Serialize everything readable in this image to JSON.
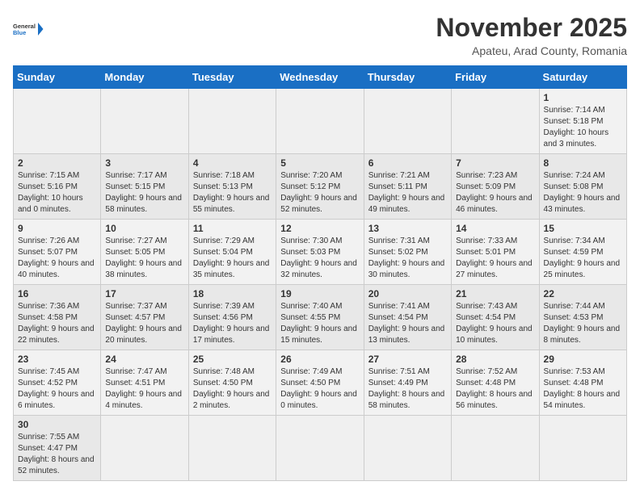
{
  "logo": {
    "text_general": "General",
    "text_blue": "Blue"
  },
  "title": "November 2025",
  "subtitle": "Apateu, Arad County, Romania",
  "weekdays": [
    "Sunday",
    "Monday",
    "Tuesday",
    "Wednesday",
    "Thursday",
    "Friday",
    "Saturday"
  ],
  "weeks": [
    [
      {
        "day": "",
        "info": ""
      },
      {
        "day": "",
        "info": ""
      },
      {
        "day": "",
        "info": ""
      },
      {
        "day": "",
        "info": ""
      },
      {
        "day": "",
        "info": ""
      },
      {
        "day": "",
        "info": ""
      },
      {
        "day": "1",
        "info": "Sunrise: 7:14 AM\nSunset: 5:18 PM\nDaylight: 10 hours and 3 minutes."
      }
    ],
    [
      {
        "day": "2",
        "info": "Sunrise: 7:15 AM\nSunset: 5:16 PM\nDaylight: 10 hours and 0 minutes."
      },
      {
        "day": "3",
        "info": "Sunrise: 7:17 AM\nSunset: 5:15 PM\nDaylight: 9 hours and 58 minutes."
      },
      {
        "day": "4",
        "info": "Sunrise: 7:18 AM\nSunset: 5:13 PM\nDaylight: 9 hours and 55 minutes."
      },
      {
        "day": "5",
        "info": "Sunrise: 7:20 AM\nSunset: 5:12 PM\nDaylight: 9 hours and 52 minutes."
      },
      {
        "day": "6",
        "info": "Sunrise: 7:21 AM\nSunset: 5:11 PM\nDaylight: 9 hours and 49 minutes."
      },
      {
        "day": "7",
        "info": "Sunrise: 7:23 AM\nSunset: 5:09 PM\nDaylight: 9 hours and 46 minutes."
      },
      {
        "day": "8",
        "info": "Sunrise: 7:24 AM\nSunset: 5:08 PM\nDaylight: 9 hours and 43 minutes."
      }
    ],
    [
      {
        "day": "9",
        "info": "Sunrise: 7:26 AM\nSunset: 5:07 PM\nDaylight: 9 hours and 40 minutes."
      },
      {
        "day": "10",
        "info": "Sunrise: 7:27 AM\nSunset: 5:05 PM\nDaylight: 9 hours and 38 minutes."
      },
      {
        "day": "11",
        "info": "Sunrise: 7:29 AM\nSunset: 5:04 PM\nDaylight: 9 hours and 35 minutes."
      },
      {
        "day": "12",
        "info": "Sunrise: 7:30 AM\nSunset: 5:03 PM\nDaylight: 9 hours and 32 minutes."
      },
      {
        "day": "13",
        "info": "Sunrise: 7:31 AM\nSunset: 5:02 PM\nDaylight: 9 hours and 30 minutes."
      },
      {
        "day": "14",
        "info": "Sunrise: 7:33 AM\nSunset: 5:01 PM\nDaylight: 9 hours and 27 minutes."
      },
      {
        "day": "15",
        "info": "Sunrise: 7:34 AM\nSunset: 4:59 PM\nDaylight: 9 hours and 25 minutes."
      }
    ],
    [
      {
        "day": "16",
        "info": "Sunrise: 7:36 AM\nSunset: 4:58 PM\nDaylight: 9 hours and 22 minutes."
      },
      {
        "day": "17",
        "info": "Sunrise: 7:37 AM\nSunset: 4:57 PM\nDaylight: 9 hours and 20 minutes."
      },
      {
        "day": "18",
        "info": "Sunrise: 7:39 AM\nSunset: 4:56 PM\nDaylight: 9 hours and 17 minutes."
      },
      {
        "day": "19",
        "info": "Sunrise: 7:40 AM\nSunset: 4:55 PM\nDaylight: 9 hours and 15 minutes."
      },
      {
        "day": "20",
        "info": "Sunrise: 7:41 AM\nSunset: 4:54 PM\nDaylight: 9 hours and 13 minutes."
      },
      {
        "day": "21",
        "info": "Sunrise: 7:43 AM\nSunset: 4:54 PM\nDaylight: 9 hours and 10 minutes."
      },
      {
        "day": "22",
        "info": "Sunrise: 7:44 AM\nSunset: 4:53 PM\nDaylight: 9 hours and 8 minutes."
      }
    ],
    [
      {
        "day": "23",
        "info": "Sunrise: 7:45 AM\nSunset: 4:52 PM\nDaylight: 9 hours and 6 minutes."
      },
      {
        "day": "24",
        "info": "Sunrise: 7:47 AM\nSunset: 4:51 PM\nDaylight: 9 hours and 4 minutes."
      },
      {
        "day": "25",
        "info": "Sunrise: 7:48 AM\nSunset: 4:50 PM\nDaylight: 9 hours and 2 minutes."
      },
      {
        "day": "26",
        "info": "Sunrise: 7:49 AM\nSunset: 4:50 PM\nDaylight: 9 hours and 0 minutes."
      },
      {
        "day": "27",
        "info": "Sunrise: 7:51 AM\nSunset: 4:49 PM\nDaylight: 8 hours and 58 minutes."
      },
      {
        "day": "28",
        "info": "Sunrise: 7:52 AM\nSunset: 4:48 PM\nDaylight: 8 hours and 56 minutes."
      },
      {
        "day": "29",
        "info": "Sunrise: 7:53 AM\nSunset: 4:48 PM\nDaylight: 8 hours and 54 minutes."
      }
    ],
    [
      {
        "day": "30",
        "info": "Sunrise: 7:55 AM\nSunset: 4:47 PM\nDaylight: 8 hours and 52 minutes."
      },
      {
        "day": "",
        "info": ""
      },
      {
        "day": "",
        "info": ""
      },
      {
        "day": "",
        "info": ""
      },
      {
        "day": "",
        "info": ""
      },
      {
        "day": "",
        "info": ""
      },
      {
        "day": "",
        "info": ""
      }
    ]
  ]
}
